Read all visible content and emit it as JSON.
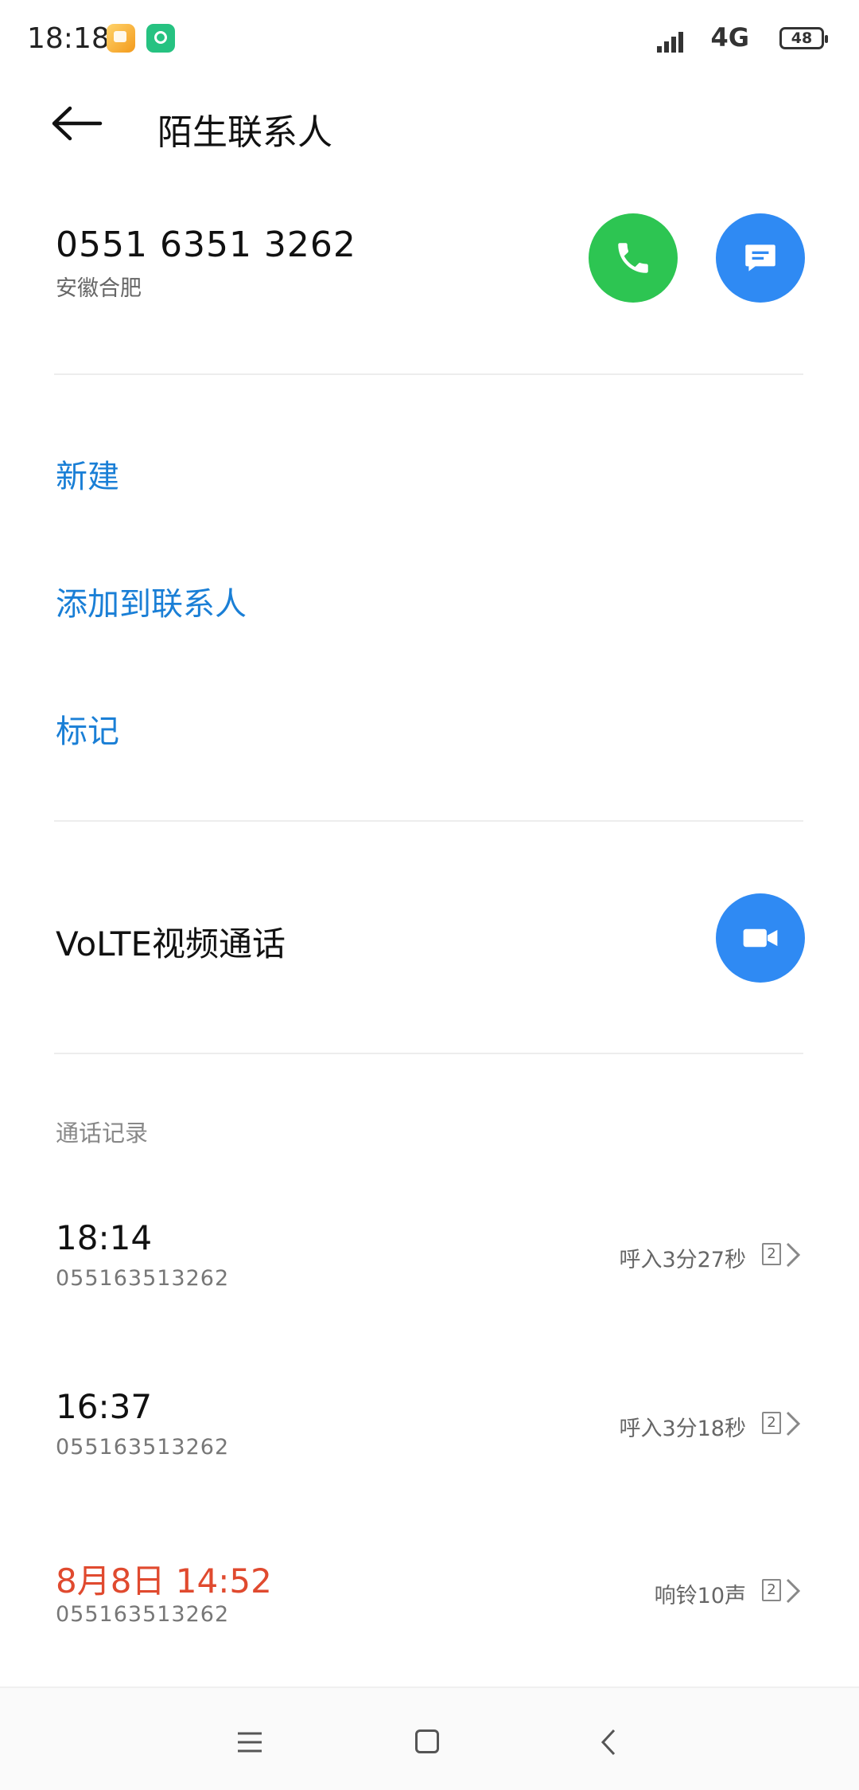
{
  "status_bar": {
    "time": "18:18",
    "network": "4G",
    "battery": "48"
  },
  "header": {
    "title": "陌生联系人"
  },
  "contact": {
    "number": "0551 6351 3262",
    "location": "安徽合肥"
  },
  "actions": {
    "new": "新建",
    "add_to_contacts": "添加到联系人",
    "mark": "标记"
  },
  "volte": {
    "label": "VoLTE视频通话"
  },
  "history": {
    "title": "通话记录",
    "items": [
      {
        "time": "18:14",
        "number": "055163513262",
        "desc": "呼入3分27秒",
        "sim": "2",
        "missed": false
      },
      {
        "time": "16:37",
        "number": "055163513262",
        "desc": "呼入3分18秒",
        "sim": "2",
        "missed": false
      },
      {
        "time": "8月8日 14:52",
        "number": "055163513262",
        "desc": "响铃10声",
        "sim": "2",
        "missed": true
      }
    ]
  },
  "colors": {
    "call_green": "#2dc552",
    "action_blue": "#2f8af3",
    "link_blue": "#1a7fd6",
    "missed_red": "#e04a2f"
  },
  "icons": {
    "back": "arrow-left-icon",
    "call": "phone-icon",
    "message": "chat-bubble-icon",
    "video": "video-camera-icon",
    "chevron": "chevron-right-icon",
    "sim": "sim-card-icon"
  }
}
